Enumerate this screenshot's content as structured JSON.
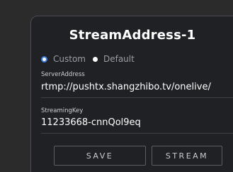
{
  "dialog": {
    "title": "StreamAddress-1"
  },
  "mode": {
    "options": [
      {
        "label": "Custom",
        "selected": true
      },
      {
        "label": "Default",
        "selected": false
      }
    ]
  },
  "server": {
    "label": "ServerAddress",
    "value": "rtmp://pushtx.shangzhibo.tv/onelive/"
  },
  "key": {
    "label": "StreamingKey",
    "value": "11233668-cnnQol9eq"
  },
  "buttons": {
    "save_label": "SAVE",
    "stream_label": "STREAM"
  },
  "colors": {
    "background": "#2b2b2b",
    "panel": "#1f2125",
    "accent_radio": "#3a7ad8"
  }
}
